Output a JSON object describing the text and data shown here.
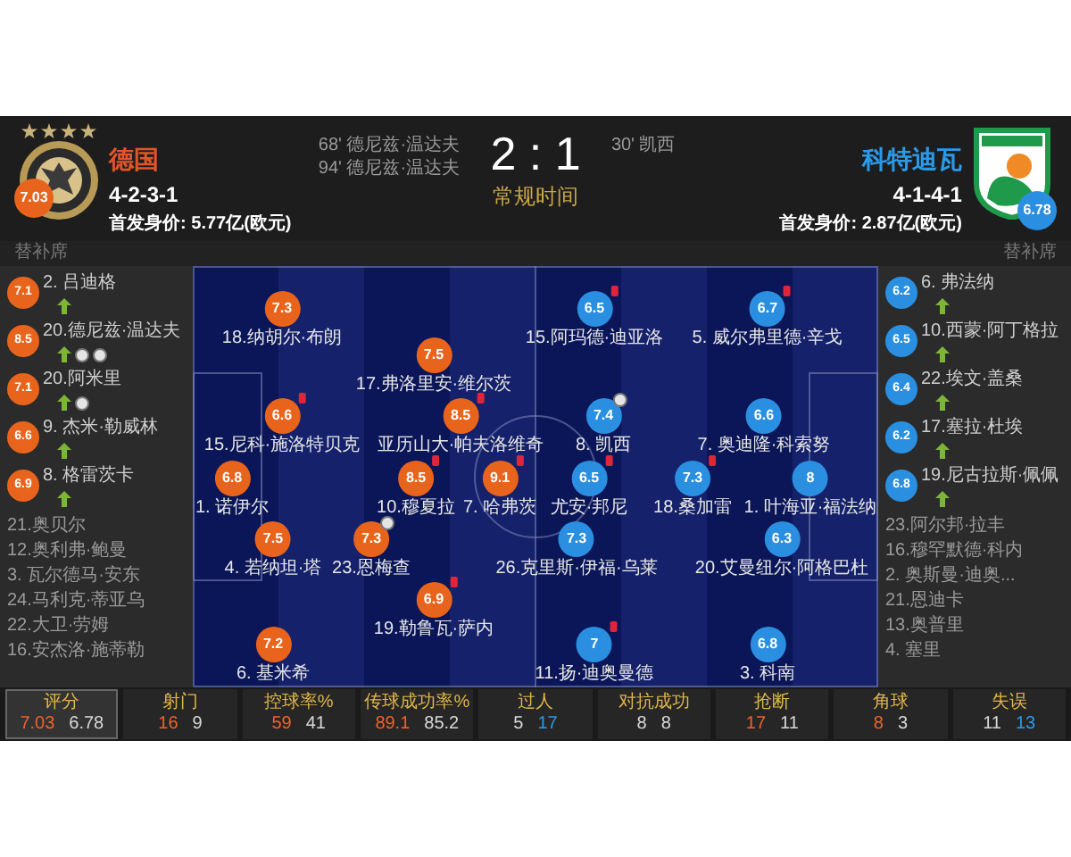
{
  "home": {
    "name": "德国",
    "formation": "4-2-3-1",
    "value": "首发身价: 5.77亿(欧元)",
    "rating": "7.03"
  },
  "away": {
    "name": "科特迪瓦",
    "formation": "4-1-4-1",
    "value": "首发身价: 2.87亿(欧元)",
    "rating": "6.78"
  },
  "score": {
    "home_events": [
      "68' 德尼兹·温达夫",
      "94' 德尼兹·温达夫"
    ],
    "result": "2 : 1",
    "status": "常规时间",
    "away_events": [
      "30' 凯西"
    ]
  },
  "home_bench": {
    "label": "替补席",
    "players": [
      {
        "kind": "rated",
        "name": "2. 吕迪格",
        "rating": "7.1",
        "events": [
          {
            "kind": "sub_on"
          }
        ]
      },
      {
        "kind": "rated",
        "name": "20.德尼兹·温达夫",
        "rating": "8.5",
        "events": [
          {
            "kind": "sub_on"
          },
          {
            "kind": "goal"
          },
          {
            "kind": "goal"
          }
        ]
      },
      {
        "kind": "rated",
        "name": "20.阿米里",
        "rating": "7.1",
        "events": [
          {
            "kind": "sub_on"
          },
          {
            "kind": "goal"
          }
        ]
      },
      {
        "kind": "rated",
        "name": "9. 杰米·勒威林",
        "rating": "6.6",
        "events": [
          {
            "kind": "sub_on"
          }
        ]
      },
      {
        "kind": "rated",
        "name": "8. 格雷茨卡",
        "rating": "6.9",
        "events": [
          {
            "kind": "sub_on"
          }
        ]
      },
      {
        "kind": "unused",
        "name": "21.奥贝尔"
      },
      {
        "kind": "unused",
        "name": "12.奥利弗·鲍曼"
      },
      {
        "kind": "unused",
        "name": "3. 瓦尔德马·安东"
      },
      {
        "kind": "unused",
        "name": "24.马利克·蒂亚乌"
      },
      {
        "kind": "unused",
        "name": "22.大卫·劳姆"
      },
      {
        "kind": "unused",
        "name": "16.安杰洛·施蒂勒"
      }
    ]
  },
  "away_bench": {
    "label": "替补席",
    "players": [
      {
        "kind": "rated",
        "name": "6. 弗法纳",
        "rating": "6.2",
        "events": [
          {
            "kind": "sub_on"
          }
        ]
      },
      {
        "kind": "rated",
        "name": "10.西蒙·阿丁格拉",
        "rating": "6.5",
        "events": [
          {
            "kind": "sub_on"
          }
        ]
      },
      {
        "kind": "rated",
        "name": "22.埃文·盖桑",
        "rating": "6.4",
        "events": [
          {
            "kind": "sub_on"
          }
        ]
      },
      {
        "kind": "rated",
        "name": "17.塞拉·杜埃",
        "rating": "6.2",
        "events": [
          {
            "kind": "sub_on"
          }
        ]
      },
      {
        "kind": "rated",
        "name": "19.尼古拉斯·佩佩",
        "rating": "6.8",
        "events": [
          {
            "kind": "sub_on"
          }
        ]
      },
      {
        "kind": "unused",
        "name": "23.阿尔邦·拉丰"
      },
      {
        "kind": "unused",
        "name": "16.穆罕默德·科内"
      },
      {
        "kind": "unused",
        "name": "2. 奥斯曼·迪奥..."
      },
      {
        "kind": "unused",
        "name": "21.恩迪卡"
      },
      {
        "kind": "unused",
        "name": "13.奥普里"
      },
      {
        "kind": "unused",
        "name": "4. 塞里"
      }
    ]
  },
  "lineup": {
    "home": [
      {
        "name": "18.纳胡尔·布朗",
        "rating": "7.3"
      },
      {
        "name": "17.弗洛里安·维尔茨",
        "rating": "7.5"
      },
      {
        "name": "15.尼科·施洛特贝克",
        "rating": "6.6",
        "events": [
          {
            "kind": "sub_off"
          }
        ]
      },
      {
        "name": "亚历山大·帕夫洛维奇",
        "rating": "8.5",
        "events": [
          {
            "kind": "sub_off"
          }
        ]
      },
      {
        "name": "1. 诺伊尔",
        "rating": "6.8"
      },
      {
        "name": "10.穆夏拉",
        "rating": "8.5",
        "events": [
          {
            "kind": "sub_off"
          }
        ]
      },
      {
        "name": "7. 哈弗茨",
        "rating": "9.1",
        "events": [
          {
            "kind": "sub_off"
          }
        ]
      },
      {
        "name": "4. 若纳坦·塔",
        "rating": "7.5"
      },
      {
        "name": "23.恩梅查",
        "rating": "7.3",
        "events": [
          {
            "kind": "goal"
          }
        ]
      },
      {
        "name": "19.勒鲁瓦·萨内",
        "rating": "6.9",
        "events": [
          {
            "kind": "sub_off"
          }
        ]
      },
      {
        "name": "6. 基米希",
        "rating": "7.2"
      }
    ],
    "away": [
      {
        "name": "15.阿玛德·迪亚洛",
        "rating": "6.5",
        "events": [
          {
            "kind": "sub_off"
          }
        ]
      },
      {
        "name": "5. 威尔弗里德·辛戈",
        "rating": "6.7",
        "events": [
          {
            "kind": "sub_off"
          }
        ]
      },
      {
        "name": "8. 凯西",
        "rating": "7.4",
        "events": [
          {
            "kind": "goal"
          }
        ]
      },
      {
        "name": "7. 奥迪隆·科索努",
        "rating": "6.6"
      },
      {
        "name": "尤安·邦尼",
        "rating": "6.5",
        "events": [
          {
            "kind": "sub_off"
          }
        ]
      },
      {
        "name": "18.桑加雷",
        "rating": "7.3",
        "events": [
          {
            "kind": "sub_off"
          }
        ]
      },
      {
        "name": "1. 叶海亚·福法纳",
        "rating": "8"
      },
      {
        "name": "26.克里斯·伊福·乌莱",
        "rating": "7.3"
      },
      {
        "name": "20.艾曼纽尔·阿格巴杜",
        "rating": "6.3"
      },
      {
        "name": "11.扬·迪奥曼德",
        "rating": "7",
        "events": [
          {
            "kind": "sub_off"
          }
        ]
      },
      {
        "name": "3. 科南",
        "rating": "6.8"
      }
    ]
  },
  "stats": [
    {
      "label": "评分",
      "home": "7.03",
      "away": "6.78",
      "home_highlighted": true,
      "away_highlighted": false,
      "selected": true
    },
    {
      "label": "射门",
      "home": "16",
      "away": "9",
      "home_highlighted": true,
      "away_highlighted": false,
      "selected": false
    },
    {
      "label": "控球率%",
      "home": "59",
      "away": "41",
      "home_highlighted": true,
      "away_highlighted": false,
      "selected": false
    },
    {
      "label": "传球成功率%",
      "home": "89.1",
      "away": "85.2",
      "home_highlighted": true,
      "away_highlighted": false,
      "selected": false
    },
    {
      "label": "过人",
      "home": "5",
      "away": "17",
      "home_highlighted": false,
      "away_highlighted": true,
      "selected": false
    },
    {
      "label": "对抗成功",
      "home": "8",
      "away": "8",
      "home_highlighted": false,
      "away_highlighted": false,
      "selected": false
    },
    {
      "label": "抢断",
      "home": "17",
      "away": "11",
      "home_highlighted": true,
      "away_highlighted": false,
      "selected": false
    },
    {
      "label": "角球",
      "home": "8",
      "away": "3",
      "home_highlighted": true,
      "away_highlighted": false,
      "selected": false
    },
    {
      "label": "失误",
      "home": "11",
      "away": "13",
      "home_highlighted": false,
      "away_highlighted": true,
      "selected": false
    }
  ]
}
